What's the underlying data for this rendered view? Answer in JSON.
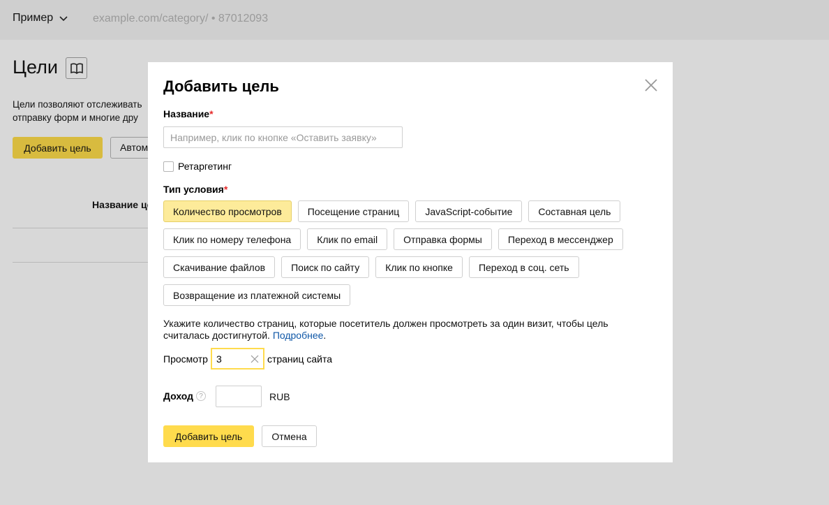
{
  "header": {
    "site_name": "Пример",
    "site_url": "example.com/category/ • 87012093"
  },
  "page": {
    "title": "Цели",
    "description_line1": "Цели позволяют отслеживать",
    "description_line2": "отправку форм и многие дру",
    "add_goal_label": "Добавить цель",
    "auto_label": "Автом",
    "column_name": "Название це"
  },
  "modal": {
    "title": "Добавить цель",
    "name_label": "Название",
    "required_mark": "*",
    "name_placeholder": "Например, клик по кнопке «Оставить заявку»",
    "name_value": "",
    "retargeting_label": "Ретаргетинг",
    "condition_label": "Тип условия",
    "condition_rows": [
      [
        "Количество просмотров",
        "Посещение страниц",
        "JavaScript-событие",
        "Составная цель"
      ],
      [
        "Клик по номеру телефона",
        "Клик по email",
        "Отправка формы",
        "Переход в мессенджер"
      ],
      [
        "Скачивание файлов",
        "Поиск по сайту",
        "Клик по кнопке",
        "Переход в соц. сеть"
      ],
      [
        "Возвращение из платежной системы"
      ]
    ],
    "selected_condition": "Количество просмотров",
    "hint_text": "Укажите количество страниц, которые посетитель должен просмотреть за один визит, чтобы цель считалась достигнутой.",
    "hint_link": "Подробнее",
    "hint_end": ".",
    "views_prefix": "Просмотр",
    "views_value": "3",
    "views_suffix": "страниц сайта",
    "income_label": "Доход",
    "income_help": "?",
    "income_value": "",
    "currency": "RUB",
    "submit_label": "Добавить цель",
    "cancel_label": "Отмена"
  },
  "colors": {
    "accent": "#ffdb4d",
    "selected_chip": "#fdeb9a",
    "link": "#0f57a7",
    "required": "#e52a2a"
  },
  "icons": {
    "site_dropdown": "chevron-down-icon",
    "docs": "book-icon",
    "close": "close-icon",
    "clear": "clear-icon",
    "help": "help-icon"
  }
}
